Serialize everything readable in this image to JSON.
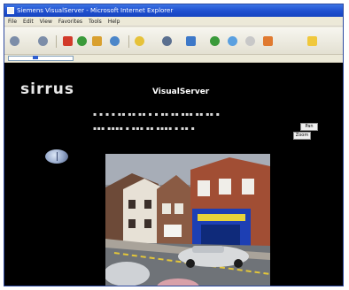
{
  "window": {
    "title": "Siemens VisualServer - Microsoft Internet Explorer"
  },
  "menu": {
    "items": [
      "File",
      "Edit",
      "View",
      "Favorites",
      "Tools",
      "Help"
    ]
  },
  "page": {
    "logo": "sirrus",
    "title": "VisualServer",
    "camera_buttons": [
      "Pan",
      "Zoom"
    ]
  },
  "colors": {
    "titlebar": "#1f4fcf",
    "page_background": "#000000",
    "sky": "#a7adb7",
    "shop_blue": "#1d3fb4"
  }
}
